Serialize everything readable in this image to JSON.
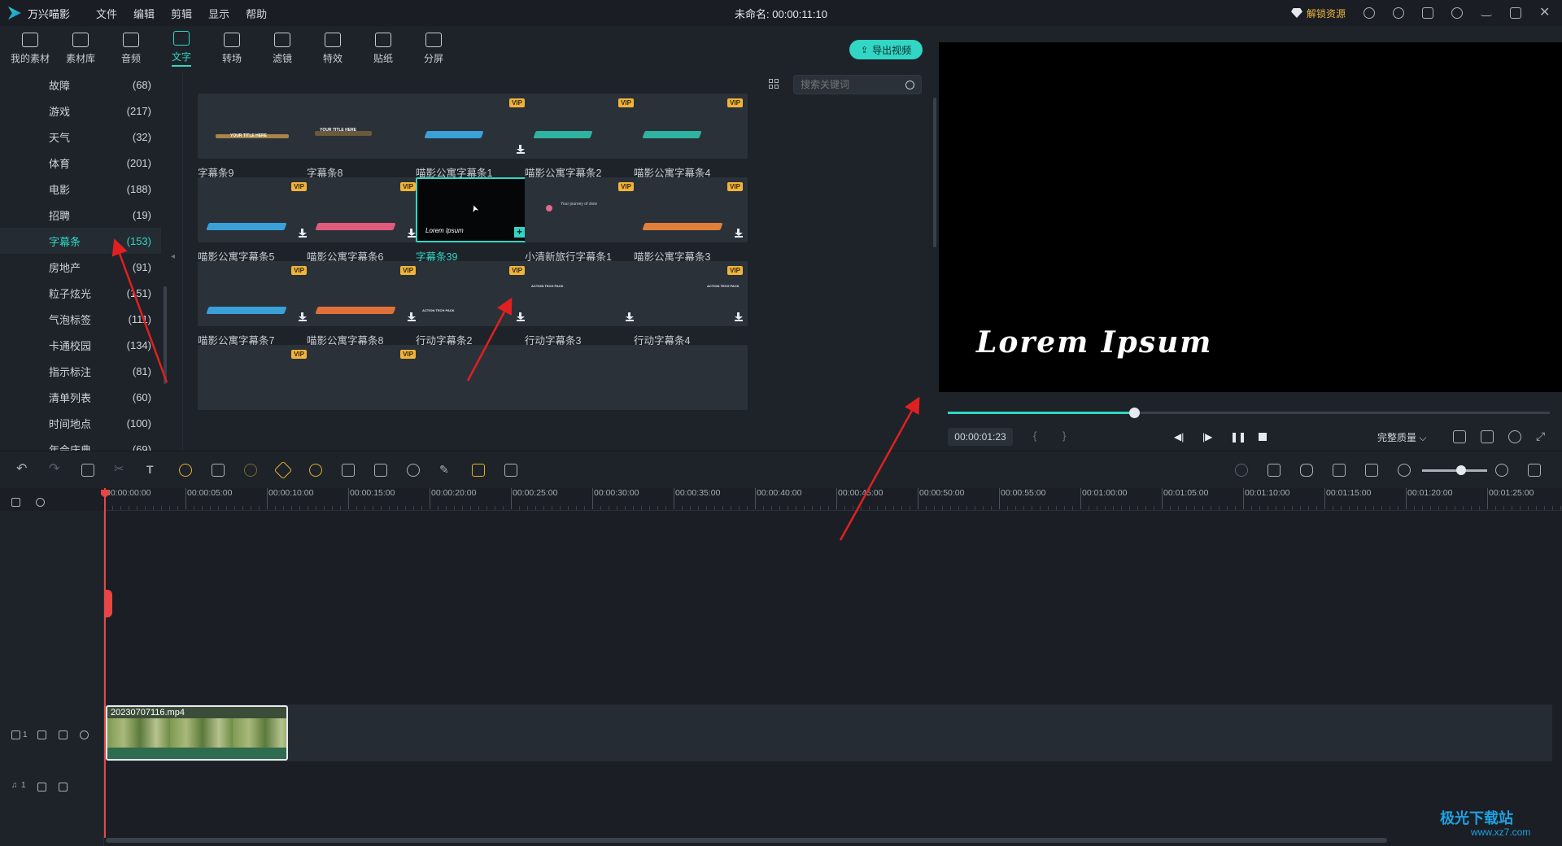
{
  "app": {
    "name": "万兴喵影",
    "menu": [
      "文件",
      "编辑",
      "剪辑",
      "显示",
      "帮助"
    ],
    "project_title": "未命名: 00:00:11:10",
    "unlock_label": "解锁资源"
  },
  "tabs": [
    {
      "label": "我的素材",
      "icon": "folder-user-icon",
      "active": false
    },
    {
      "label": "素材库",
      "icon": "folder-icon",
      "active": false
    },
    {
      "label": "音频",
      "icon": "music-note-icon",
      "active": false
    },
    {
      "label": "文字",
      "icon": "text-icon",
      "active": true
    },
    {
      "label": "转场",
      "icon": "transition-icon",
      "active": false
    },
    {
      "label": "滤镜",
      "icon": "filter-icon",
      "active": false
    },
    {
      "label": "特效",
      "icon": "effects-icon",
      "active": false
    },
    {
      "label": "贴纸",
      "icon": "sticker-icon",
      "active": false
    },
    {
      "label": "分屏",
      "icon": "split-screen-icon",
      "active": false
    }
  ],
  "export_label": "导出视频",
  "search": {
    "placeholder": "搜索关键词"
  },
  "categories": [
    {
      "label": "故障",
      "count": "(68)"
    },
    {
      "label": "游戏",
      "count": "(217)"
    },
    {
      "label": "天气",
      "count": "(32)"
    },
    {
      "label": "体育",
      "count": "(201)"
    },
    {
      "label": "电影",
      "count": "(188)"
    },
    {
      "label": "招聘",
      "count": "(19)"
    },
    {
      "label": "字幕条",
      "count": "(153)",
      "active": true
    },
    {
      "label": "房地产",
      "count": "(91)"
    },
    {
      "label": "粒子炫光",
      "count": "(151)"
    },
    {
      "label": "气泡标签",
      "count": "(111)"
    },
    {
      "label": "卡通校园",
      "count": "(134)"
    },
    {
      "label": "指示标注",
      "count": "(81)"
    },
    {
      "label": "清单列表",
      "count": "(60)"
    },
    {
      "label": "时间地点",
      "count": "(100)"
    },
    {
      "label": "年会庆典",
      "count": "(69)"
    }
  ],
  "assets": [
    {
      "name": "字幕条9",
      "vip": false,
      "download": false
    },
    {
      "name": "字幕条8",
      "vip": false,
      "download": false
    },
    {
      "name": "喵影公寓字幕条1",
      "vip": true,
      "download": true
    },
    {
      "name": "喵影公寓字幕条2",
      "vip": true,
      "download": false
    },
    {
      "name": "喵影公寓字幕条4",
      "vip": true,
      "download": false
    },
    {
      "name": "喵影公寓字幕条5",
      "vip": true,
      "download": true
    },
    {
      "name": "喵影公寓字幕条6",
      "vip": true,
      "download": true
    },
    {
      "name": "字幕条39",
      "vip": false,
      "download": false,
      "selected": true
    },
    {
      "name": "小清新旅行字幕条1",
      "vip": true,
      "download": false
    },
    {
      "name": "喵影公寓字幕条3",
      "vip": true,
      "download": true
    },
    {
      "name": "喵影公寓字幕条7",
      "vip": true,
      "download": true
    },
    {
      "name": "喵影公寓字幕条8",
      "vip": true,
      "download": true
    },
    {
      "name": "行动字幕条2",
      "vip": true,
      "download": true
    },
    {
      "name": "行动字幕条3",
      "vip": false,
      "download": true
    },
    {
      "name": "行动字幕条4",
      "vip": true,
      "download": true
    },
    {
      "name": "",
      "vip": true,
      "download": false
    },
    {
      "name": "",
      "vip": true,
      "download": false
    },
    {
      "name": "",
      "vip": false,
      "download": false
    },
    {
      "name": "",
      "vip": false,
      "download": false
    },
    {
      "name": "",
      "vip": false,
      "download": false
    }
  ],
  "vip_label": "VIP",
  "preview": {
    "overlay_text": "Lorem Ipsum",
    "timecode": "00:00:01:23",
    "progress": 0.31,
    "quality": "完整质量"
  },
  "timeline": {
    "ruler": [
      "00:00:00:00",
      "00:00:05:00",
      "00:00:10:00",
      "00:00:15:00",
      "00:00:20:00",
      "00:00:25:00",
      "00:00:30:00",
      "00:00:35:00",
      "00:00:40:00",
      "00:00:45:00",
      "00:00:50:00",
      "00:00:55:00",
      "00:01:00:00",
      "00:01:05:00",
      "00:01:10:00",
      "00:01:15:00",
      "00:01:20:00",
      "00:01:25:00"
    ],
    "clip_name": "20230707116.mp4",
    "video_track_label": "1",
    "audio_track_label": "1"
  },
  "thumb_texts": {
    "t9": "YOUR TITLE HERE",
    "t8": "YOUR TITLE HERE",
    "travel": "Your journey of slow",
    "action": "ACTION TECH PACK",
    "script": "Lorem Ipsum"
  },
  "watermark": {
    "main": "极光下载站",
    "sub": "www.xz7.com"
  },
  "colors": {
    "accent": "#31d6c4",
    "vip": "#f0b43c",
    "arrow": "#e02020"
  }
}
